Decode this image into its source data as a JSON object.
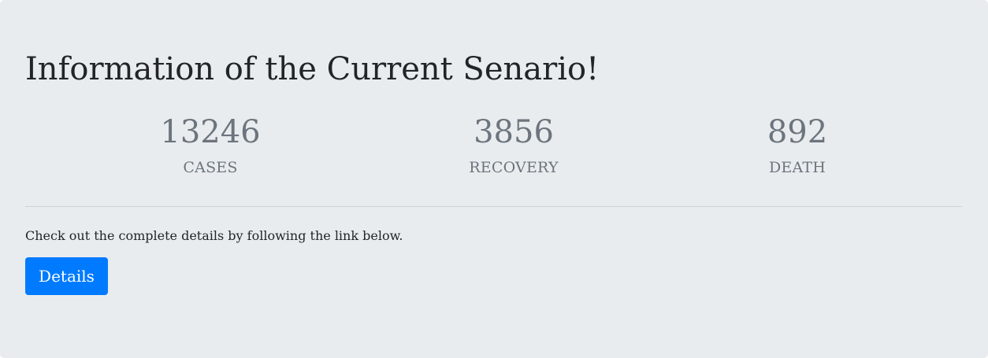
{
  "jumbotron": {
    "title": "Information of the Current Senario!",
    "stats": [
      {
        "value": "13246",
        "label": "CASES"
      },
      {
        "value": "3856",
        "label": "RECOVERY"
      },
      {
        "value": "892",
        "label": "DEATH"
      }
    ],
    "description": "Check out the complete details by following the link below.",
    "button_label": "Details"
  },
  "colors": {
    "background": "#e9ecef",
    "primary_button": "#007bff",
    "muted_text": "#6c757d",
    "body_text": "#212529"
  }
}
